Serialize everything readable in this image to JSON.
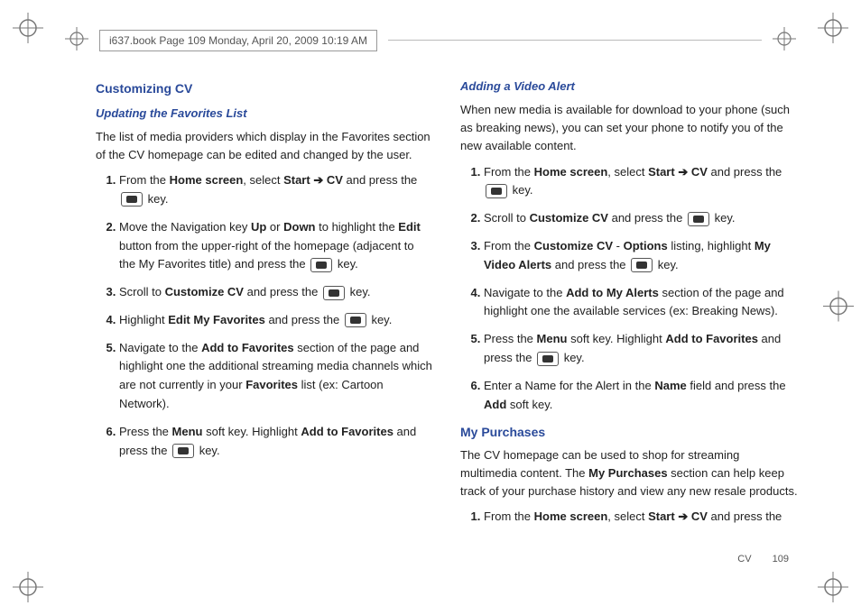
{
  "header": {
    "meta": "i637.book  Page 109  Monday, April 20, 2009  10:19 AM"
  },
  "footer": {
    "section": "CV",
    "page": "109"
  },
  "left": {
    "h2": "Customizing CV",
    "h3": "Updating the Favorites List",
    "intro": "The list of media providers which display in the Favorites section of the CV homepage can be edited and changed by the user.",
    "s1a": "From the ",
    "s1b": "Home screen",
    "s1c": ", select ",
    "s1d": "Start",
    "s1e": "CV",
    "s1f": " and press the ",
    "s1g": " key.",
    "s2a": "Move the Navigation key ",
    "s2b": "Up",
    "s2c": " or ",
    "s2d": "Down",
    "s2e": " to highlight the ",
    "s2f": "Edit",
    "s2g": " button from the upper-right of the homepage (adjacent to the My Favorites title) and press the ",
    "s2h": " key.",
    "s3a": "Scroll to ",
    "s3b": "Customize CV",
    "s3c": " and press the ",
    "s3d": " key.",
    "s4a": "Highlight ",
    "s4b": "Edit My Favorites",
    "s4c": " and press the ",
    "s4d": " key.",
    "s5a": "Navigate to the ",
    "s5b": "Add to Favorites",
    "s5c": " section of the page and highlight one the additional streaming media channels which are not currently in your ",
    "s5d": "Favorites",
    "s5e": " list (ex: Cartoon Network).",
    "s6a": "Press the ",
    "s6b": "Menu",
    "s6c": " soft key. Highlight ",
    "s6d": "Add to Favorites",
    "s6e": " and press the ",
    "s6f": " key."
  },
  "right": {
    "h3": "Adding a Video Alert",
    "intro": "When new media is available for download to your phone (such as breaking news), you can set your phone to notify you of the new available content.",
    "s1a": "From the ",
    "s1b": "Home screen",
    "s1c": ", select ",
    "s1d": "Start",
    "s1e": "CV",
    "s1f": " and press the ",
    "s1g": " key.",
    "s2a": "Scroll to ",
    "s2b": "Customize CV",
    "s2c": " and press the ",
    "s2d": " key.",
    "s3a": "From the ",
    "s3b": "Customize CV",
    "s3c": " - ",
    "s3d": "Options",
    "s3e": " listing, highlight ",
    "s3f": "My Video Alerts",
    "s3g": " and press the ",
    "s3h": " key.",
    "s4a": "Navigate to the ",
    "s4b": "Add to My Alerts",
    "s4c": " section of the page and highlight one the available services (ex: Breaking News).",
    "s5a": "Press the ",
    "s5b": "Menu",
    "s5c": " soft key. Highlight ",
    "s5d": "Add to Favorites",
    "s5e": " and press the ",
    "s5f": " key.",
    "s6a": "Enter a Name for the Alert in the ",
    "s6b": "Name",
    "s6c": " field and press the ",
    "s6d": "Add",
    "s6e": " soft key.",
    "h2b": "My Purchases",
    "intro2a": "The CV homepage can be used to shop for streaming multimedia content. The ",
    "intro2b": "My Purchases",
    "intro2c": " section can help keep track of your purchase history and view any new resale products.",
    "p1a": "From the ",
    "p1b": "Home screen",
    "p1c": ", select ",
    "p1d": "Start",
    "p1e": "CV",
    "p1f": " and press the"
  }
}
